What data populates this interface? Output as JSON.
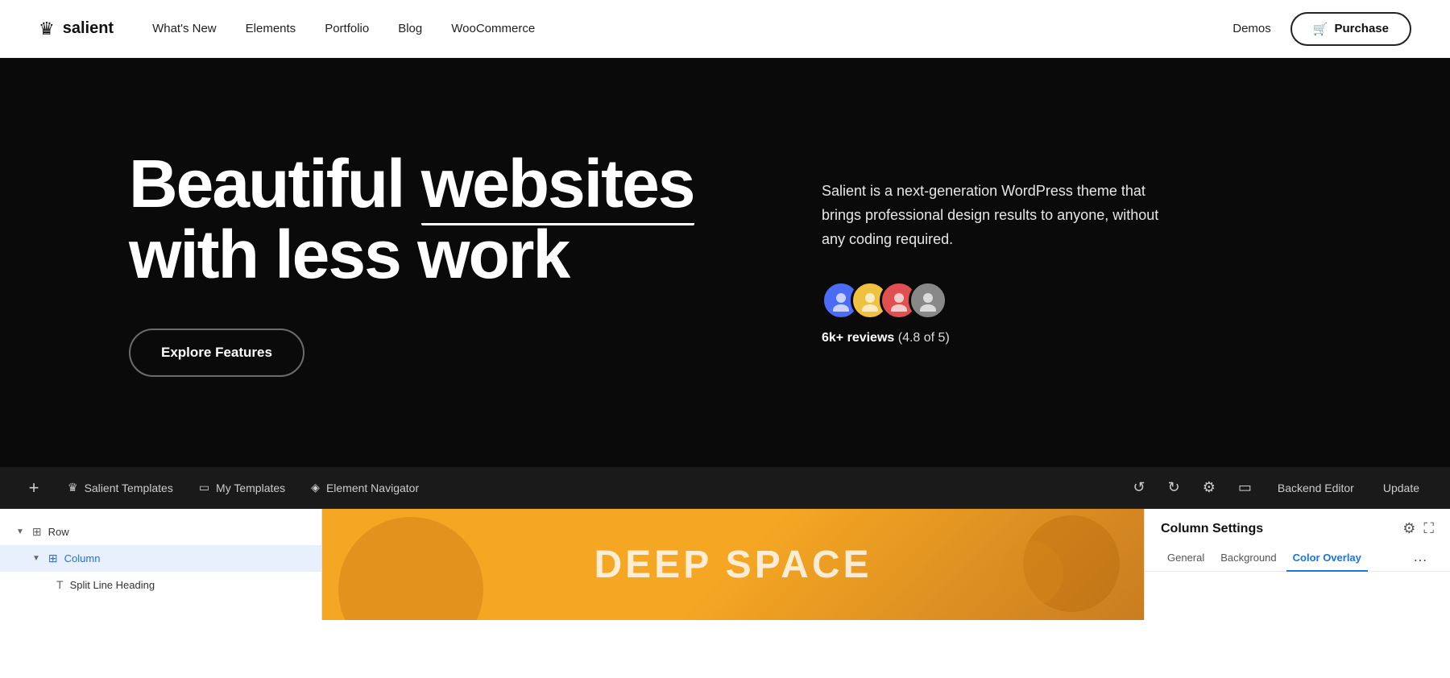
{
  "brand": {
    "logo_icon": "♛",
    "name": "salient"
  },
  "navbar": {
    "links": [
      {
        "label": "What's New",
        "id": "whats-new"
      },
      {
        "label": "Elements",
        "id": "elements"
      },
      {
        "label": "Portfolio",
        "id": "portfolio"
      },
      {
        "label": "Blog",
        "id": "blog"
      },
      {
        "label": "WooCommerce",
        "id": "woocommerce"
      }
    ],
    "demos_label": "Demos",
    "purchase_label": "Purchase",
    "cart_icon": "🛒"
  },
  "hero": {
    "heading_line1_normal": "Beautiful",
    "heading_line1_underline": "websites",
    "heading_line2": "with less work",
    "description": "Salient is a next-generation WordPress theme that brings professional design results to anyone, without any coding required.",
    "explore_button": "Explore Features",
    "reviews_count": "6k+ reviews",
    "reviews_rating": "(4.8 of 5)"
  },
  "editor_toolbar": {
    "plus_icon": "+",
    "salient_templates_label": "Salient Templates",
    "my_templates_label": "My Templates",
    "element_navigator_label": "Element Navigator",
    "undo_icon": "↺",
    "redo_icon": "↻",
    "settings_icon": "⚙",
    "layout_icon": "▭",
    "backend_editor_label": "Backend Editor",
    "update_label": "Update"
  },
  "editor_tree": {
    "items": [
      {
        "label": "Row",
        "indent": 0,
        "icon": "▦",
        "arrow": "▼",
        "selected": false
      },
      {
        "label": "Column",
        "indent": 1,
        "icon": "▦",
        "arrow": "▼",
        "selected": true
      },
      {
        "label": "Split Line Heading",
        "indent": 2,
        "icon": "T",
        "arrow": "",
        "selected": false
      }
    ]
  },
  "column_settings": {
    "title": "Column Settings",
    "gear_icon": "⚙",
    "resize_icon": "⛶",
    "tabs": [
      {
        "label": "General",
        "active": false
      },
      {
        "label": "Background",
        "active": false
      },
      {
        "label": "Color Overlay",
        "active": true
      }
    ],
    "more_icon": "…"
  },
  "preview": {
    "text": "DEEP SPACE"
  }
}
